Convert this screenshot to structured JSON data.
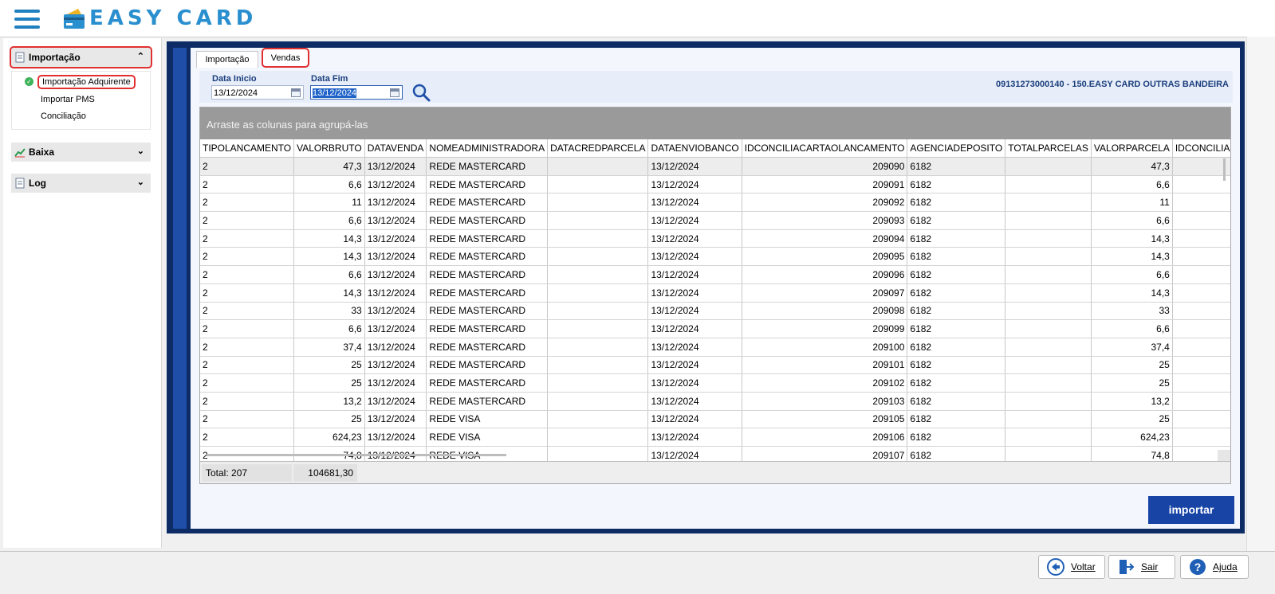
{
  "app": {
    "logo_text": "EASY CARD"
  },
  "sidebar": {
    "groups": [
      {
        "label": "Importação",
        "expanded": true,
        "chevron": "⌃"
      },
      {
        "label": "Baixa",
        "expanded": false,
        "chevron": "⌄"
      },
      {
        "label": "Log",
        "expanded": false,
        "chevron": "⌄"
      }
    ],
    "sub_items": [
      "Importação Adquirente",
      "Importar PMS",
      "Conciliação"
    ]
  },
  "tabs": [
    "Importação",
    "Vendas"
  ],
  "filters": {
    "start_label": "Data Inicio",
    "start_value": "13/12/2024",
    "end_label": "Data Fim",
    "end_value": "13/12/2024"
  },
  "company": "09131273000140 - 150.EASY CARD OUTRAS BANDEIRA",
  "grid": {
    "group_hint": "Arraste as colunas para agrupá-las",
    "columns": [
      "TIPOLANCAMENTO",
      "VALORBRUTO",
      "DATAVENDA",
      "NOMEADMINISTRADORA",
      "DATACREDPARCELA",
      "DATAENVIOBANCO",
      "IDCONCILIACARTAOLANCAMENTO",
      "AGENCIADEPOSITO",
      "TOTALPARCELAS",
      "VALORPARCELA",
      "IDCONCILIACARTAOTI"
    ],
    "rows": [
      [
        "2",
        "47,3",
        "13/12/2024",
        "REDE MASTERCARD",
        "",
        "13/12/2024",
        "209090",
        "6182",
        "",
        "47,3",
        ""
      ],
      [
        "2",
        "6,6",
        "13/12/2024",
        "REDE MASTERCARD",
        "",
        "13/12/2024",
        "209091",
        "6182",
        "",
        "6,6",
        ""
      ],
      [
        "2",
        "11",
        "13/12/2024",
        "REDE MASTERCARD",
        "",
        "13/12/2024",
        "209092",
        "6182",
        "",
        "11",
        ""
      ],
      [
        "2",
        "6,6",
        "13/12/2024",
        "REDE MASTERCARD",
        "",
        "13/12/2024",
        "209093",
        "6182",
        "",
        "6,6",
        ""
      ],
      [
        "2",
        "14,3",
        "13/12/2024",
        "REDE MASTERCARD",
        "",
        "13/12/2024",
        "209094",
        "6182",
        "",
        "14,3",
        ""
      ],
      [
        "2",
        "14,3",
        "13/12/2024",
        "REDE MASTERCARD",
        "",
        "13/12/2024",
        "209095",
        "6182",
        "",
        "14,3",
        ""
      ],
      [
        "2",
        "6,6",
        "13/12/2024",
        "REDE MASTERCARD",
        "",
        "13/12/2024",
        "209096",
        "6182",
        "",
        "6,6",
        ""
      ],
      [
        "2",
        "14,3",
        "13/12/2024",
        "REDE MASTERCARD",
        "",
        "13/12/2024",
        "209097",
        "6182",
        "",
        "14,3",
        ""
      ],
      [
        "2",
        "33",
        "13/12/2024",
        "REDE MASTERCARD",
        "",
        "13/12/2024",
        "209098",
        "6182",
        "",
        "33",
        ""
      ],
      [
        "2",
        "6,6",
        "13/12/2024",
        "REDE MASTERCARD",
        "",
        "13/12/2024",
        "209099",
        "6182",
        "",
        "6,6",
        ""
      ],
      [
        "2",
        "37,4",
        "13/12/2024",
        "REDE MASTERCARD",
        "",
        "13/12/2024",
        "209100",
        "6182",
        "",
        "37,4",
        ""
      ],
      [
        "2",
        "25",
        "13/12/2024",
        "REDE MASTERCARD",
        "",
        "13/12/2024",
        "209101",
        "6182",
        "",
        "25",
        ""
      ],
      [
        "2",
        "25",
        "13/12/2024",
        "REDE MASTERCARD",
        "",
        "13/12/2024",
        "209102",
        "6182",
        "",
        "25",
        ""
      ],
      [
        "2",
        "13,2",
        "13/12/2024",
        "REDE MASTERCARD",
        "",
        "13/12/2024",
        "209103",
        "6182",
        "",
        "13,2",
        ""
      ],
      [
        "2",
        "25",
        "13/12/2024",
        "REDE VISA",
        "",
        "13/12/2024",
        "209105",
        "6182",
        "",
        "25",
        ""
      ],
      [
        "2",
        "624,23",
        "13/12/2024",
        "REDE VISA",
        "",
        "13/12/2024",
        "209106",
        "6182",
        "",
        "624,23",
        ""
      ],
      [
        "2",
        "74,8",
        "13/12/2024",
        "REDE VISA",
        "",
        "13/12/2024",
        "209107",
        "6182",
        "",
        "74,8",
        ""
      ]
    ],
    "footer_total": "Total: 207",
    "footer_sum": "104681,30"
  },
  "import_button": "importar",
  "bottom_buttons": [
    "Voltar",
    "Sair",
    "Ajuda"
  ],
  "colors": {
    "accent": "#1844a6",
    "frame": "#0d2c66",
    "highlight": "#e03030",
    "logo": "#2a8fcf"
  }
}
